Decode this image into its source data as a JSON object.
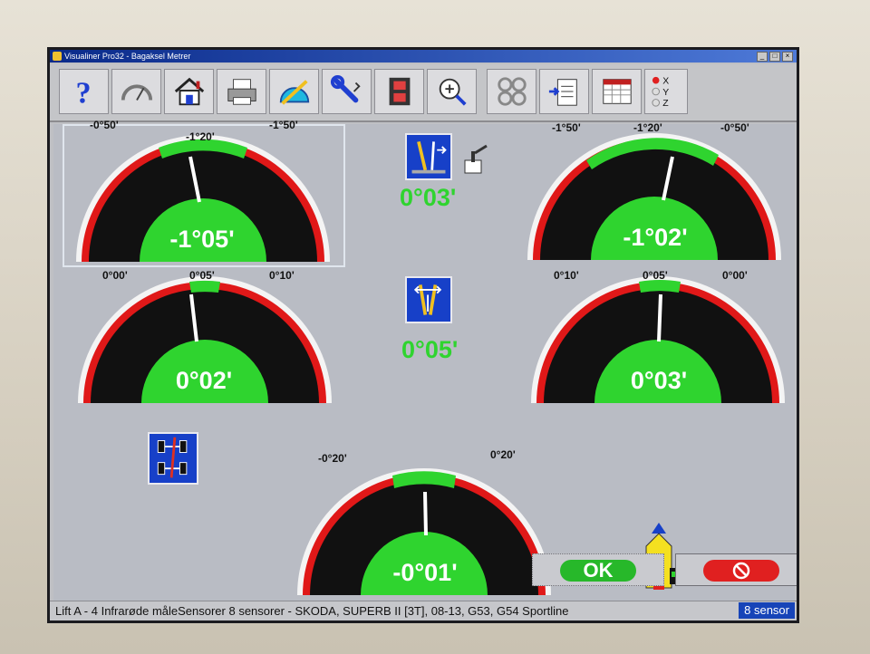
{
  "window": {
    "title": "Visualiner Pro32 - Bagaksel Metrer"
  },
  "toolbar": {
    "buttons": [
      {
        "name": "help-icon"
      },
      {
        "name": "gauge-icon"
      },
      {
        "name": "home-icon"
      },
      {
        "name": "printer-icon"
      },
      {
        "name": "protractor-icon"
      },
      {
        "name": "wrench-icon"
      },
      {
        "name": "film-icon"
      },
      {
        "name": "magnifier-icon"
      },
      {
        "name": "chain-icon"
      },
      {
        "name": "clipboard-icon"
      },
      {
        "name": "spreadsheet-icon"
      }
    ],
    "axis_options": [
      "X",
      "Y",
      "Z"
    ]
  },
  "gauges": {
    "camber_left": {
      "left_label": "-0°50'",
      "center_label": "-1°20'",
      "right_label": "-1°50'",
      "value": "-1°05'"
    },
    "camber_right": {
      "left_label": "-1°50'",
      "center_label": "-1°20'",
      "right_label": "-0°50'",
      "value": "-1°02'"
    },
    "toe_left": {
      "left_label": "0°00'",
      "center_label": "0°05'",
      "right_label": "0°10'",
      "value": "0°02'"
    },
    "toe_right": {
      "left_label": "0°10'",
      "center_label": "0°05'",
      "right_label": "0°00'",
      "value": "0°03'"
    },
    "thrust": {
      "left_label": "-0°20'",
      "right_label": "0°20'",
      "value": "-0°01'"
    }
  },
  "cross_values": {
    "camber_diff": "0°03'",
    "total_toe": "0°05'"
  },
  "buttons": {
    "ok_label": "OK"
  },
  "status": {
    "text": "Lift A - 4 Infrarøde måleSensorer 8 sensorer - SKODA, SUPERB II [3T], 08-13, G53, G54 Sportline",
    "sensor_badge": "8 sensor"
  },
  "colors": {
    "green": "#2fd42f",
    "red": "#e01818",
    "blue": "#1740c8"
  }
}
